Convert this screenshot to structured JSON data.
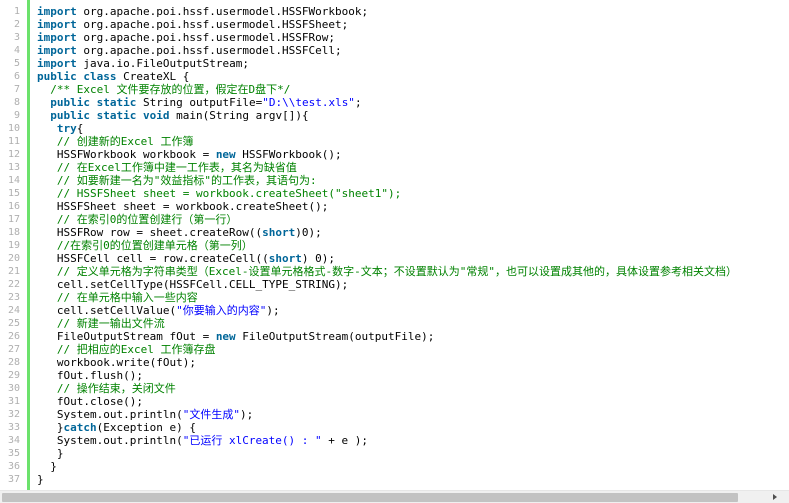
{
  "code_lines": [
    [
      [
        "kw",
        "import"
      ],
      [
        "tx",
        " org.apache.poi.hssf.usermodel.HSSFWorkbook;"
      ]
    ],
    [
      [
        "kw",
        "import"
      ],
      [
        "tx",
        " org.apache.poi.hssf.usermodel.HSSFSheet;"
      ]
    ],
    [
      [
        "kw",
        "import"
      ],
      [
        "tx",
        " org.apache.poi.hssf.usermodel.HSSFRow;"
      ]
    ],
    [
      [
        "kw",
        "import"
      ],
      [
        "tx",
        " org.apache.poi.hssf.usermodel.HSSFCell;"
      ]
    ],
    [
      [
        "kw",
        "import"
      ],
      [
        "tx",
        " java.io.FileOutputStream;"
      ]
    ],
    [
      [
        "kw",
        "public"
      ],
      [
        "tx",
        " "
      ],
      [
        "kw",
        "class"
      ],
      [
        "tx",
        " CreateXL {"
      ]
    ],
    [
      [
        "tx",
        "  "
      ],
      [
        "cm",
        "/** Excel 文件要存放的位置，假定在D盘下*/"
      ]
    ],
    [
      [
        "tx",
        "  "
      ],
      [
        "kw",
        "public"
      ],
      [
        "tx",
        " "
      ],
      [
        "kw",
        "static"
      ],
      [
        "tx",
        " String outputFile="
      ],
      [
        "st",
        "\"D:\\\\test.xls\""
      ],
      [
        "tx",
        ";"
      ]
    ],
    [
      [
        "tx",
        "  "
      ],
      [
        "kw",
        "public"
      ],
      [
        "tx",
        " "
      ],
      [
        "kw",
        "static"
      ],
      [
        "tx",
        " "
      ],
      [
        "kw",
        "void"
      ],
      [
        "tx",
        " main(String argv[]){"
      ]
    ],
    [
      [
        "tx",
        "   "
      ],
      [
        "kw",
        "try"
      ],
      [
        "tx",
        "{"
      ]
    ],
    [
      [
        "tx",
        "   "
      ],
      [
        "cm",
        "// 创建新的Excel 工作簿"
      ]
    ],
    [
      [
        "tx",
        "   HSSFWorkbook workbook = "
      ],
      [
        "kw",
        "new"
      ],
      [
        "tx",
        " HSSFWorkbook();"
      ]
    ],
    [
      [
        "tx",
        "   "
      ],
      [
        "cm",
        "// 在Excel工作簿中建一工作表，其名为缺省值"
      ]
    ],
    [
      [
        "tx",
        "   "
      ],
      [
        "cm",
        "// 如要新建一名为\"效益指标\"的工作表，其语句为:"
      ]
    ],
    [
      [
        "tx",
        "   "
      ],
      [
        "cm",
        "// HSSFSheet sheet = workbook.createSheet(\"sheet1\");"
      ]
    ],
    [
      [
        "tx",
        "   HSSFSheet sheet = workbook.createSheet();"
      ]
    ],
    [
      [
        "tx",
        "   "
      ],
      [
        "cm",
        "// 在索引0的位置创建行（第一行）"
      ]
    ],
    [
      [
        "tx",
        "   HSSFRow row = sheet.createRow(("
      ],
      [
        "kw",
        "short"
      ],
      [
        "tx",
        ")0);"
      ]
    ],
    [
      [
        "tx",
        "   "
      ],
      [
        "cm",
        "//在索引0的位置创建单元格（第一列）"
      ]
    ],
    [
      [
        "tx",
        "   HSSFCell cell = row.createCell(("
      ],
      [
        "kw",
        "short"
      ],
      [
        "tx",
        ") 0);"
      ]
    ],
    [
      [
        "tx",
        "   "
      ],
      [
        "cm",
        "// 定义单元格为字符串类型（Excel-设置单元格格式-数字-文本；不设置默认为\"常规\"，也可以设置成其他的，具体设置参考相关文档）"
      ]
    ],
    [
      [
        "tx",
        "   cell.setCellType(HSSFCell.CELL_TYPE_STRING);"
      ]
    ],
    [
      [
        "tx",
        "   "
      ],
      [
        "cm",
        "// 在单元格中输入一些内容"
      ]
    ],
    [
      [
        "tx",
        "   cell.setCellValue("
      ],
      [
        "st",
        "\"你要输入的内容\""
      ],
      [
        "tx",
        ");"
      ]
    ],
    [
      [
        "tx",
        "   "
      ],
      [
        "cm",
        "// 新建一输出文件流"
      ]
    ],
    [
      [
        "tx",
        "   FileOutputStream fOut = "
      ],
      [
        "kw",
        "new"
      ],
      [
        "tx",
        " FileOutputStream(outputFile);"
      ]
    ],
    [
      [
        "tx",
        "   "
      ],
      [
        "cm",
        "// 把相应的Excel 工作簿存盘"
      ]
    ],
    [
      [
        "tx",
        "   workbook.write(fOut);"
      ]
    ],
    [
      [
        "tx",
        "   fOut.flush();"
      ]
    ],
    [
      [
        "tx",
        "   "
      ],
      [
        "cm",
        "// 操作结束，关闭文件"
      ]
    ],
    [
      [
        "tx",
        "   fOut.close();"
      ]
    ],
    [
      [
        "tx",
        "   System.out.println("
      ],
      [
        "st",
        "\"文件生成\""
      ],
      [
        "tx",
        ");"
      ]
    ],
    [
      [
        "tx",
        "   }"
      ],
      [
        "kw",
        "catch"
      ],
      [
        "tx",
        "(Exception e) {"
      ]
    ],
    [
      [
        "tx",
        "   System.out.println("
      ],
      [
        "st",
        "\"已运行 xlCreate() : \""
      ],
      [
        "tx",
        " + e );"
      ]
    ],
    [
      [
        "tx",
        "   }"
      ]
    ],
    [
      [
        "tx",
        "  }"
      ]
    ],
    [
      [
        "tx",
        "}"
      ]
    ]
  ],
  "colors": {
    "keyword": "#006699",
    "comment": "#008200",
    "string": "#0000ff",
    "gutter_bar": "#6ce26c",
    "line_number": "#afafaf"
  }
}
